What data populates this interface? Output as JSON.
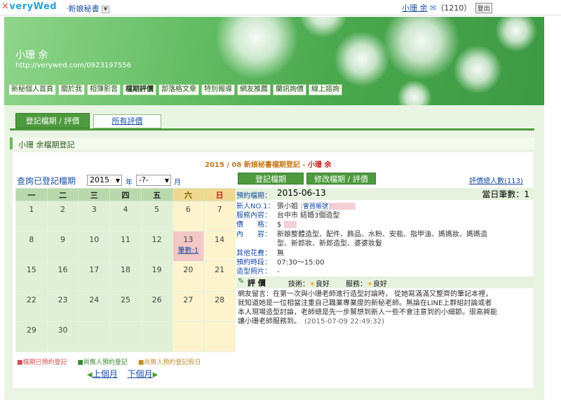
{
  "topbar": {
    "logo_prefix": "✕",
    "logo_text": "veryWed",
    "subsite": "新娘秘書",
    "user_name": "小珊 余",
    "mail_count": "（1210）",
    "logout": "登出"
  },
  "banner": {
    "name": "小珊 余",
    "url": "http://verywed.com/0923197556"
  },
  "nav": [
    "新秘個人首頁",
    "關於我",
    "相簿影音",
    "檔期評價",
    "部落格文章",
    "特別報導",
    "網友推薦",
    "蘭訊詢價",
    "線上諮詢"
  ],
  "tabs": {
    "active": "登記檔期 / 評價",
    "other": "所有評價"
  },
  "section_title": "小珊 余檔期登記",
  "page_title": {
    "prefix": "2015 / 08",
    "middle": "新娘秘書檔期登記 - ",
    "name": "小珊 余"
  },
  "query": {
    "label": "查詢已登記檔期",
    "year": "2015",
    "year_unit": "年",
    "month": "-?-",
    "month_unit": "月"
  },
  "calendar": {
    "weekdays": [
      "一",
      "二",
      "三",
      "四",
      "五",
      "六",
      "日"
    ],
    "weeks": [
      [
        "1",
        "2",
        "3",
        "4",
        "5",
        "6",
        "7"
      ],
      [
        "8",
        "9",
        "10",
        "11",
        "12",
        "13",
        "14"
      ],
      [
        "15",
        "16",
        "17",
        "18",
        "19",
        "20",
        "21"
      ],
      [
        "22",
        "23",
        "24",
        "25",
        "26",
        "27",
        "28"
      ],
      [
        "29",
        "30",
        "",
        "",
        "",
        "",
        ""
      ]
    ],
    "booking_label": "筆數:1"
  },
  "legend": {
    "booked": "檔期已預約登記",
    "free": "尚無人預約登記",
    "free_holiday": "尚無人預約登記假日"
  },
  "pager": {
    "prev": "上個月",
    "next": "下個月"
  },
  "buttons": {
    "register": "登記檔期",
    "edit": "修改檔期 / 評價"
  },
  "total_link": "評價總人數(113)",
  "detail": {
    "date_label": "預約檔期：",
    "date": "2015-06-13",
    "count_label": "當日筆數：",
    "count": "1",
    "rows": [
      {
        "k": "新人NO.1：",
        "v": "張小姐",
        "chip": "會員帳號"
      },
      {
        "k": "服務內容：",
        "v": "台中市 結婚3個造型"
      },
      {
        "k": "價　　格：",
        "v": "$"
      },
      {
        "k": "內　　容：",
        "v": "新娘整體造型、配件、飾品、水粉、安瓶、指甲油、媽媽妝、媽媽造"
      },
      {
        "k": "",
        "v": "型、新郎妝、新郎造型、婆婆妝髮"
      },
      {
        "k": "其他花費：",
        "v": "無"
      },
      {
        "k": "預約時段：",
        "v": "07:30～15:00"
      },
      {
        "k": "造型照片：",
        "v": "-"
      }
    ]
  },
  "review": {
    "title": "評 價",
    "tech_label": "技術：",
    "tech": "良好",
    "service_label": "服務：",
    "service": "良好",
    "lines": [
      "網友留言：在第一次與小珊老師進行造型討論時， 從她寫滿滿又整齊的筆記本裡，",
      "就知道她是一位相當注重自己職業專業度的新秘老師。無論在LINE上群組討論或者",
      "本人現場造型討論，老師總是先一步幫想到新人一些不會注意到的小細節。很高興能",
      "讓小珊老師服務到。"
    ],
    "timestamp": "(2015-07-09 22:49:32)"
  }
}
